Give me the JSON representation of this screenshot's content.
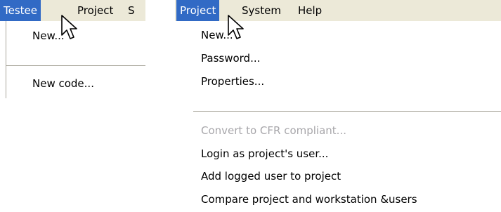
{
  "left_panel": {
    "menubar": {
      "items": [
        "Testee",
        "Project",
        "S"
      ]
    },
    "dropdown": {
      "items": [
        "New...",
        "New code..."
      ]
    }
  },
  "right_panel": {
    "menubar": {
      "items": [
        "Project",
        "System",
        "Help"
      ]
    },
    "dropdown": {
      "items": [
        "New...",
        "Password...",
        "Properties...",
        "Convert to CFR compliant...",
        "Login as project's user...",
        "Add logged user to project",
        "Compare project and workstation &users"
      ],
      "disabled_item": "Convert to CFR compliant..."
    }
  },
  "colors": {
    "menu_highlight": "#316ac5",
    "menubar_bg": "#ece9d8",
    "disabled_text": "#a7a6aa",
    "separator": "#a9a79c"
  },
  "icons": {
    "cursor": "arrow-pointer-icon"
  }
}
